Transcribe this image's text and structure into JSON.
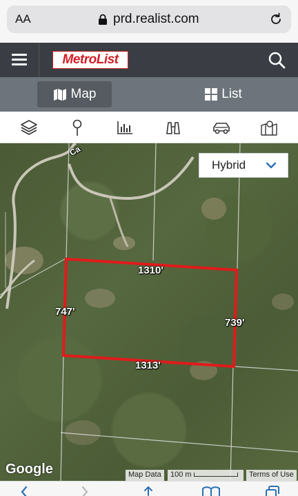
{
  "browser": {
    "text_size_label": "AA",
    "url": "prd.realist.com"
  },
  "header": {
    "logo_text": "MetroList",
    "menu_icon": "hamburger-icon",
    "search_icon": "search-icon"
  },
  "tabs": [
    {
      "label": "Map",
      "icon": "map-icon",
      "selected": true
    },
    {
      "label": "List",
      "icon": "grid-icon",
      "selected": false
    }
  ],
  "tools": [
    {
      "icon": "layers-icon"
    },
    {
      "icon": "pin-icon"
    },
    {
      "icon": "bar-chart-icon"
    },
    {
      "icon": "binoculars-icon"
    },
    {
      "icon": "car-icon"
    },
    {
      "icon": "map-pin-area-icon"
    }
  ],
  "map": {
    "map_type": "Hybrid",
    "dimensions": {
      "top": "1310'",
      "left": "747'",
      "right": "739'",
      "bottom": "1313'"
    },
    "road_label": "Ca",
    "google_label": "Google",
    "attribution": {
      "map_data": "Map Data",
      "scale": "100 m",
      "terms": "Terms of Use"
    },
    "parcel_color": "#e01b1b"
  }
}
